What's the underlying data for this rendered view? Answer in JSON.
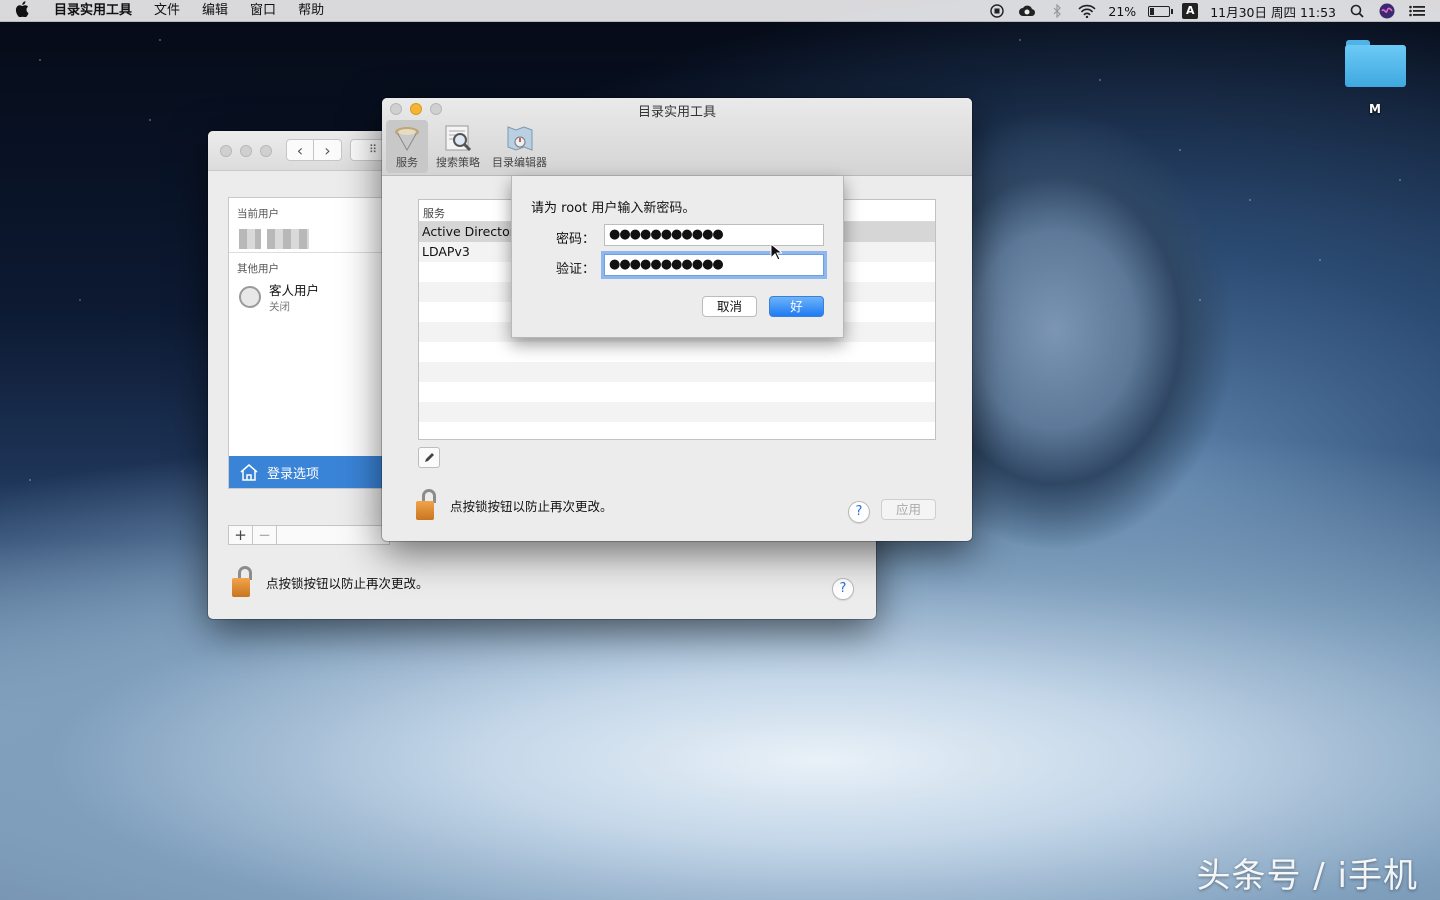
{
  "menubar": {
    "app_name": "目录实用工具",
    "menus": [
      "文件",
      "编辑",
      "窗口",
      "帮助"
    ],
    "battery_percent": "21%",
    "battery_level": 0.21,
    "input_method": "A",
    "datetime": "11月30日 周四 11:53"
  },
  "desktop": {
    "folder_label": "M",
    "folder_color": "#4fb3e8",
    "watermark": "头条号 / i手机"
  },
  "users_window": {
    "current_user_header": "当前用户",
    "other_users_header": "其他用户",
    "guest_name": "客人用户",
    "guest_status": "关闭",
    "login_options": "登录选项",
    "lock_text": "点按锁按钮以防止再次更改。",
    "help": "?"
  },
  "directory_utility": {
    "title": "目录实用工具",
    "toolbar": [
      {
        "label": "服务",
        "icon": "services-icon",
        "selected": true
      },
      {
        "label": "搜索策略",
        "icon": "search-policy-icon",
        "selected": false
      },
      {
        "label": "目录编辑器",
        "icon": "directory-editor-icon",
        "selected": false
      }
    ],
    "table_header": "服务",
    "services": [
      "Active Director",
      "LDAPv3"
    ],
    "lock_text": "点按锁按钮以防止再次更改。",
    "help": "?",
    "apply_label": "应用"
  },
  "sheet": {
    "prompt": "请为 root 用户输入新密码。",
    "password_label": "密码：",
    "password_value": "●●●●●●●●●●●",
    "verify_label": "验证：",
    "verify_value": "●●●●●●●●●●●",
    "cancel_label": "取消",
    "ok_label": "好",
    "accent": "#1e7bf2"
  }
}
